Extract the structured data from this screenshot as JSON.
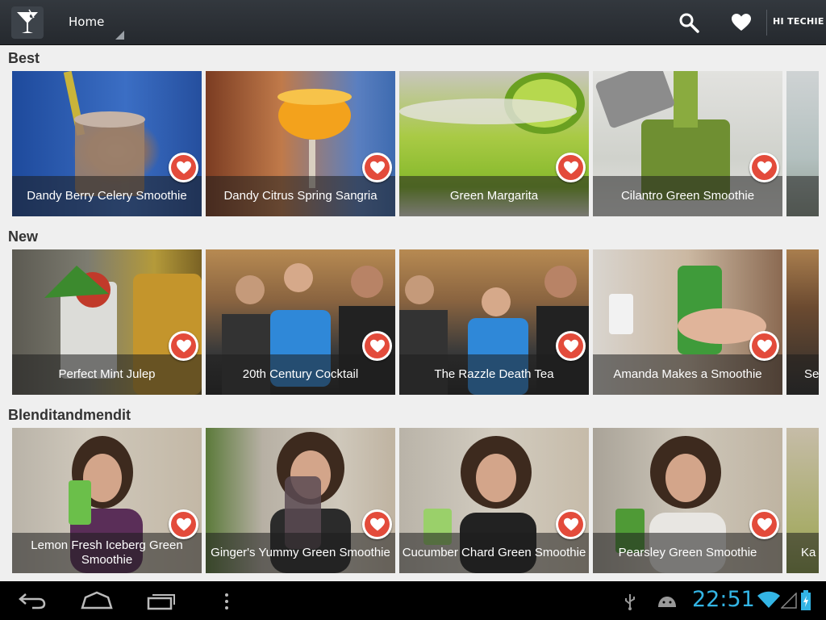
{
  "actionbar": {
    "title": "Home",
    "user_label": "HI TECHIE"
  },
  "sections": [
    {
      "title": "Best",
      "items": [
        {
          "title": "Dandy Berry Celery Smoothie"
        },
        {
          "title": "Dandy Citrus Spring Sangria"
        },
        {
          "title": "Green Margarita"
        },
        {
          "title": "Cilantro Green Smoothie"
        },
        {
          "title": ""
        }
      ]
    },
    {
      "title": "New",
      "items": [
        {
          "title": "Perfect Mint Julep"
        },
        {
          "title": "20th Century Cocktail"
        },
        {
          "title": "The Razzle Death Tea"
        },
        {
          "title": "Amanda Makes a Smoothie"
        },
        {
          "title": "Se"
        }
      ]
    },
    {
      "title": "Blenditandmendit",
      "items": [
        {
          "title": "Lemon Fresh Iceberg Green Smoothie"
        },
        {
          "title": "Ginger's Yummy Green Smoothie"
        },
        {
          "title": "Cucumber Chard Green Smoothie"
        },
        {
          "title": "Pearsley Green Smoothie"
        },
        {
          "title": "Ka"
        }
      ]
    }
  ],
  "statusbar": {
    "time": "22:51"
  },
  "colors": {
    "accent": "#33b5e5",
    "favorite": "#e34b3b",
    "actionbar": "#2b2f34"
  },
  "icons": {
    "app": "cocktail-glass-icon",
    "search": "search-icon",
    "favorites": "heart-icon",
    "back": "back-icon",
    "home": "home-icon",
    "recents": "recent-apps-icon",
    "menu": "overflow-menu-icon",
    "usb": "usb-icon",
    "debug": "android-debug-icon",
    "wifi": "wifi-icon",
    "signal": "signal-icon",
    "battery": "battery-charging-icon"
  }
}
